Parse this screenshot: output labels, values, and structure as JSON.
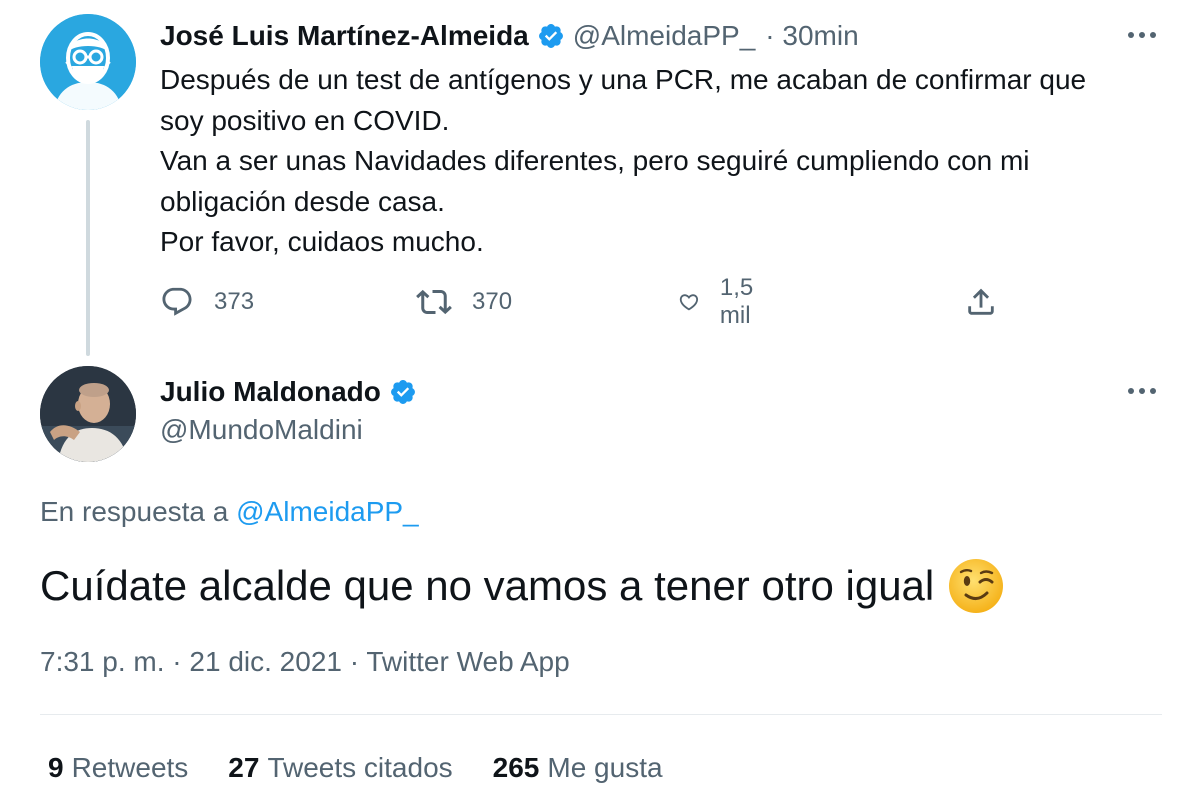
{
  "original_tweet": {
    "author_name": "José Luis Martínez-Almeida",
    "author_handle": "@AlmeidaPP_",
    "time": "· 30min",
    "text_lines": [
      "Después de un test de antígenos y una PCR, me acaban de confirmar que",
      "soy positivo en COVID.",
      "Van a ser unas Navidades diferentes, pero seguiré cumpliendo con mi",
      "obligación desde casa.",
      "Por favor, cuidaos mucho."
    ],
    "actions": {
      "replies": "373",
      "retweets": "370",
      "likes": "1,5 mil"
    },
    "icons": [
      "more-icon",
      "reply-icon",
      "retweet-icon",
      "like-icon",
      "share-icon",
      "verified-badge-icon"
    ]
  },
  "reply_tweet": {
    "author_name": "Julio Maldonado",
    "author_handle": "@MundoMaldini",
    "replying_to_prefix": "En respuesta a ",
    "replying_to_handle": "@AlmeidaPP_",
    "text": "Cuídate alcalde que no vamos a tener otro igual",
    "emoji": "winking-face-emoji",
    "timestamp": "7:31 p. m. · 21 dic. 2021 · Twitter Web App",
    "stats": {
      "retweets_count": "9",
      "retweets_label": "Retweets",
      "quotes_count": "27",
      "quotes_label": "Tweets citados",
      "likes_count": "265",
      "likes_label": "Me gusta"
    }
  },
  "colors": {
    "accent": "#1d9bf0",
    "text_primary": "#0f1419",
    "text_secondary": "#536471",
    "thread_line": "#cfd9de",
    "avatar1_bg": "#2aa7e0"
  }
}
